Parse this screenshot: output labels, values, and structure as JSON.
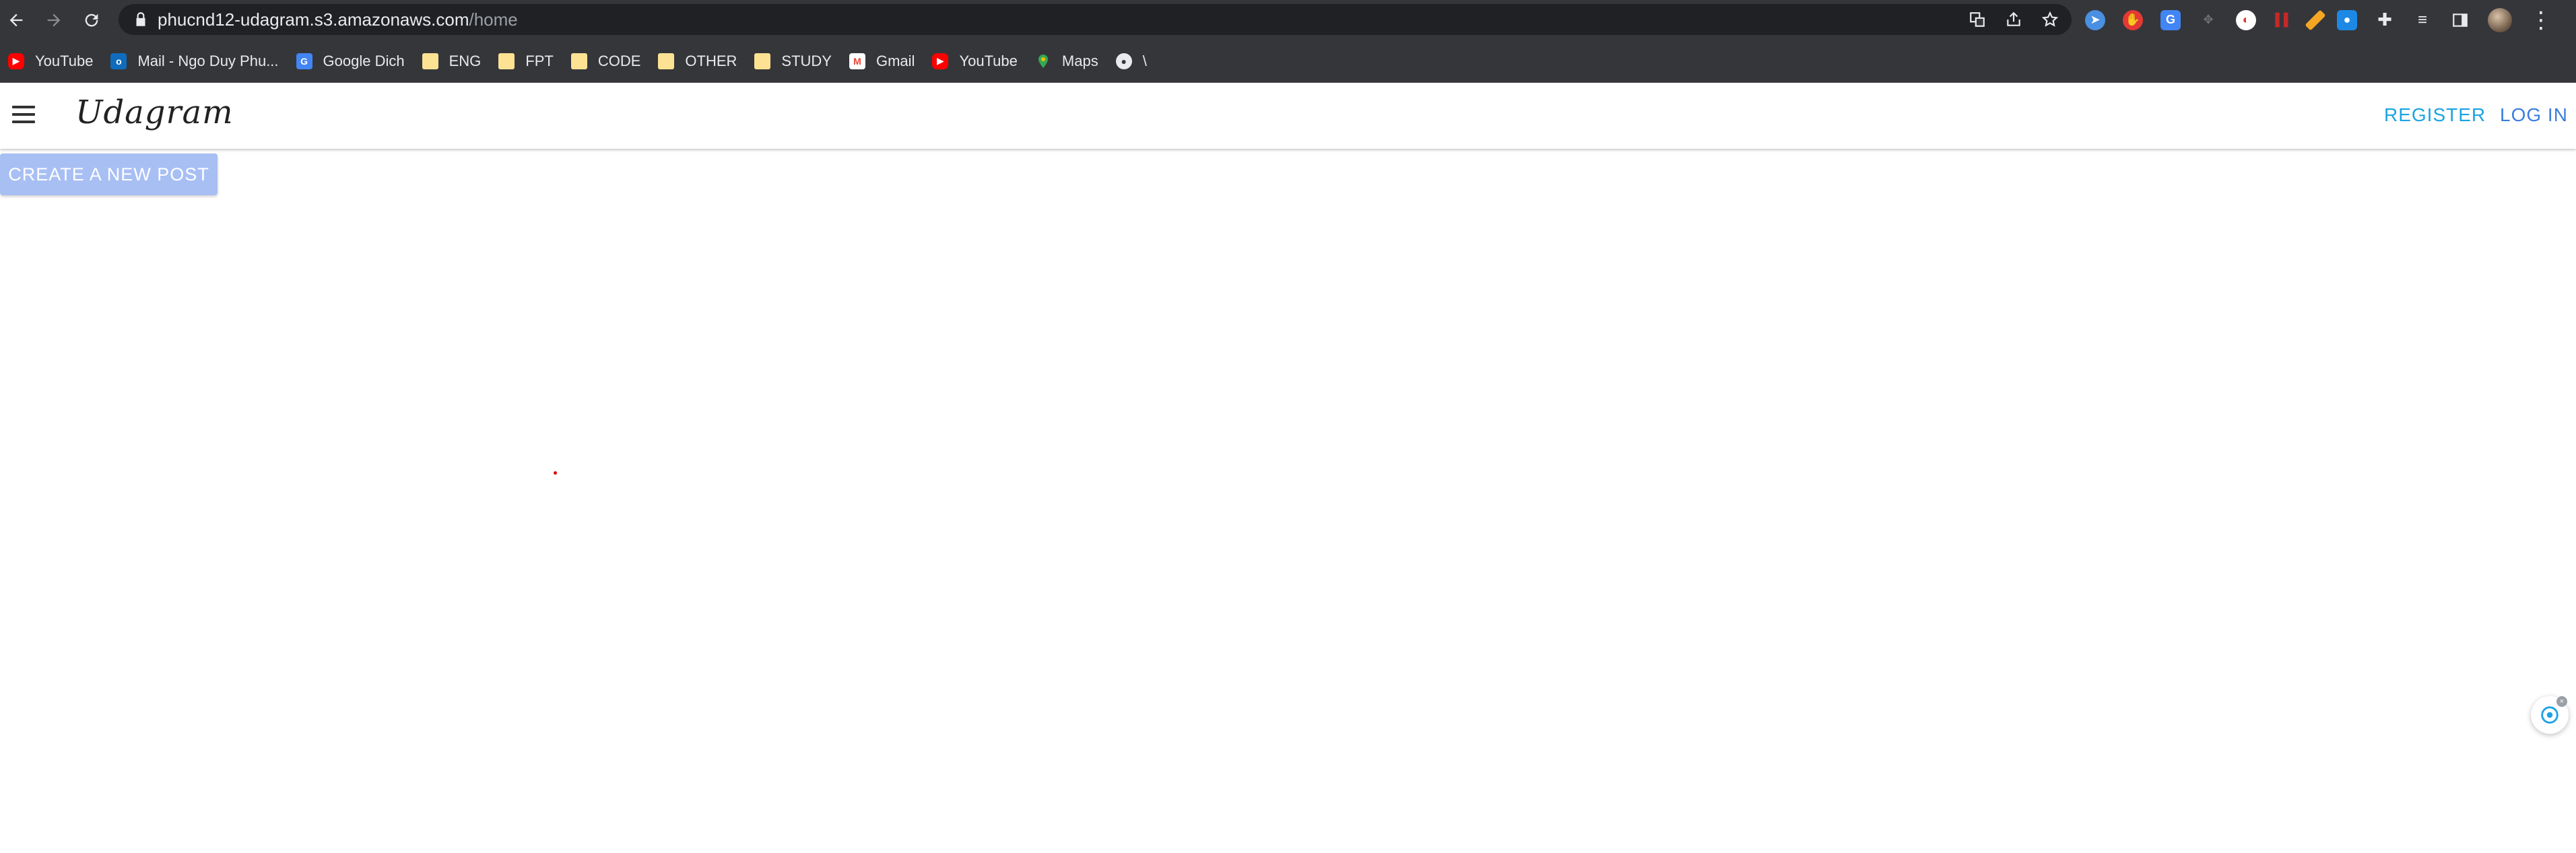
{
  "browser": {
    "url_host": "phucnd12-udagram.s3.amazonaws.com",
    "url_path": "/home",
    "bookmarks": [
      {
        "label": "YouTube",
        "icon": "youtube-icon"
      },
      {
        "label": "Mail - Ngo Duy Phu...",
        "icon": "outlook-icon"
      },
      {
        "label": "Google Dich",
        "icon": "google-translate-icon"
      },
      {
        "label": "ENG",
        "icon": "folder-icon"
      },
      {
        "label": "FPT",
        "icon": "folder-icon"
      },
      {
        "label": "CODE",
        "icon": "folder-icon"
      },
      {
        "label": "OTHER",
        "icon": "folder-icon"
      },
      {
        "label": "STUDY",
        "icon": "folder-icon"
      },
      {
        "label": "Gmail",
        "icon": "gmail-icon"
      },
      {
        "label": "YouTube",
        "icon": "youtube-icon"
      },
      {
        "label": "Maps",
        "icon": "maps-icon"
      },
      {
        "label": "\\",
        "icon": "github-icon"
      }
    ]
  },
  "app": {
    "brand": "Udagram",
    "register_label": "REGISTER",
    "login_label": "LOG IN",
    "create_post_label": "CREATE A NEW POST"
  },
  "colors": {
    "chrome_bg": "#35363a",
    "register": "#1aa3e4",
    "login": "#3b7ddd",
    "create_button_bg": "#a8bff4"
  }
}
